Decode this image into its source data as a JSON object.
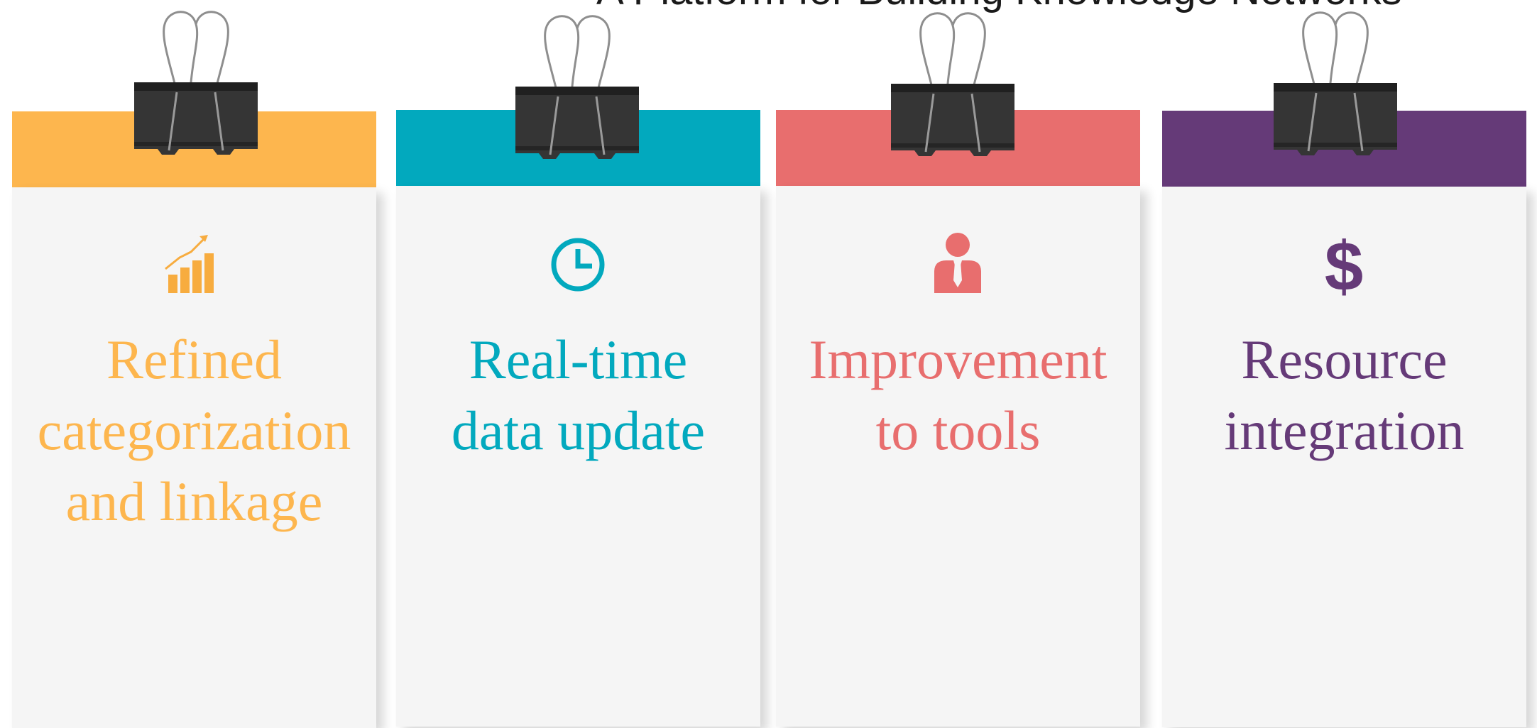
{
  "page": {
    "title": "A Platform for Building Knowledge Networks"
  },
  "cards": [
    {
      "lines": [
        "Refined",
        "categorization",
        "and linkage"
      ],
      "color": "#FDB64E",
      "icon": "growth-chart-icon"
    },
    {
      "lines": [
        "Real-time",
        "data update"
      ],
      "color": "#02A9BE",
      "icon": "clock-icon"
    },
    {
      "lines": [
        "Improvement",
        "to tools"
      ],
      "color": "#E86E6E",
      "icon": "businessman-icon"
    },
    {
      "lines": [
        "Resource",
        "integration"
      ],
      "color": "#653A78",
      "icon": "dollar-icon"
    }
  ]
}
